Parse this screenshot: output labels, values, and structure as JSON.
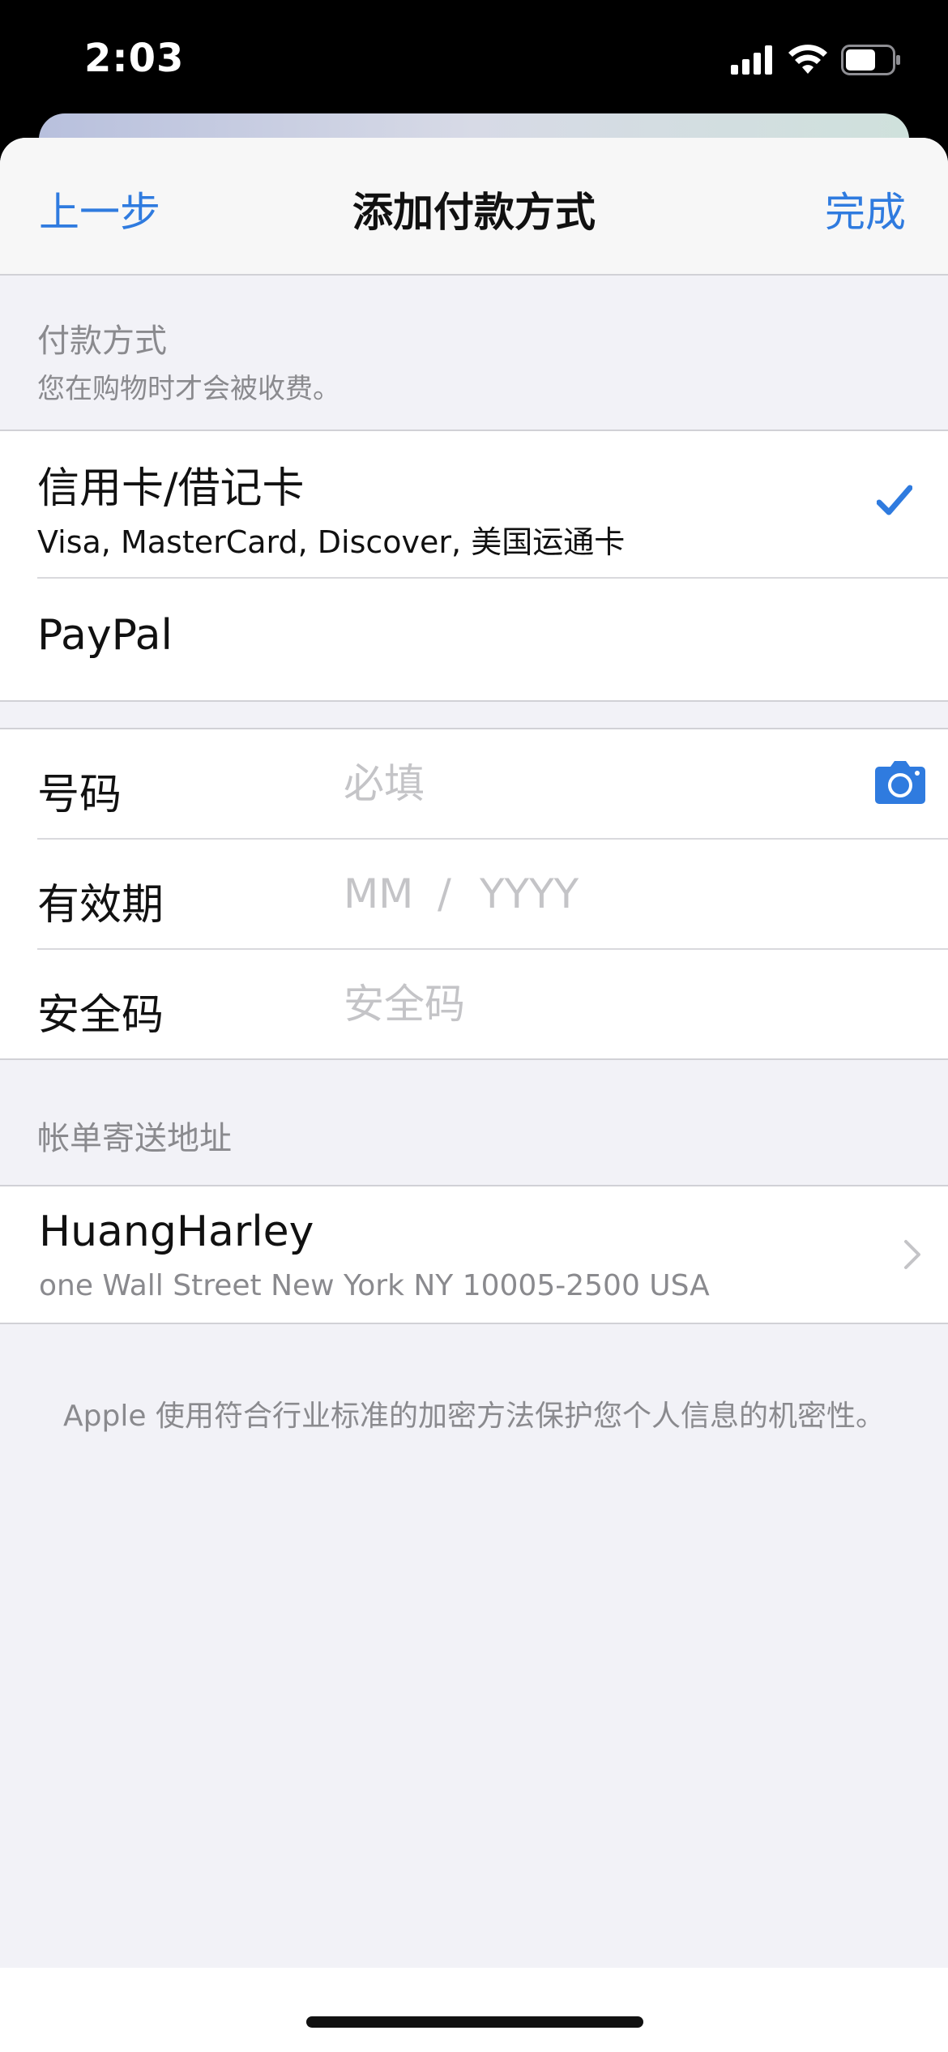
{
  "status_bar": {
    "time": "2:03",
    "icons": [
      "signal-icon",
      "wifi-icon",
      "battery-icon"
    ]
  },
  "nav": {
    "back_label": "上一步",
    "title": "添加付款方式",
    "done_label": "完成",
    "accent_color": "#2f7bdf"
  },
  "payment_method": {
    "header": "付款方式",
    "subheader": "您在购物时才会被收费。",
    "options": [
      {
        "title": "信用卡/借记卡",
        "subtitle": "Visa, MasterCard, Discover, 美国运通卡",
        "selected": true
      },
      {
        "title": "PayPal",
        "selected": false
      }
    ]
  },
  "card_fields": {
    "number": {
      "label": "号码",
      "placeholder": "必填"
    },
    "expiry": {
      "label": "有效期",
      "month_placeholder": "MM",
      "divider": "/",
      "year_placeholder": "YYYY"
    },
    "security": {
      "label": "安全码",
      "placeholder": "安全码"
    }
  },
  "billing": {
    "header": "帐单寄送地址",
    "name": "HuangHarley",
    "address": "one Wall Street New York NY 10005-2500 USA"
  },
  "footer_note": "Apple 使用符合行业标准的加密方法保护您个人信息的机密性。"
}
